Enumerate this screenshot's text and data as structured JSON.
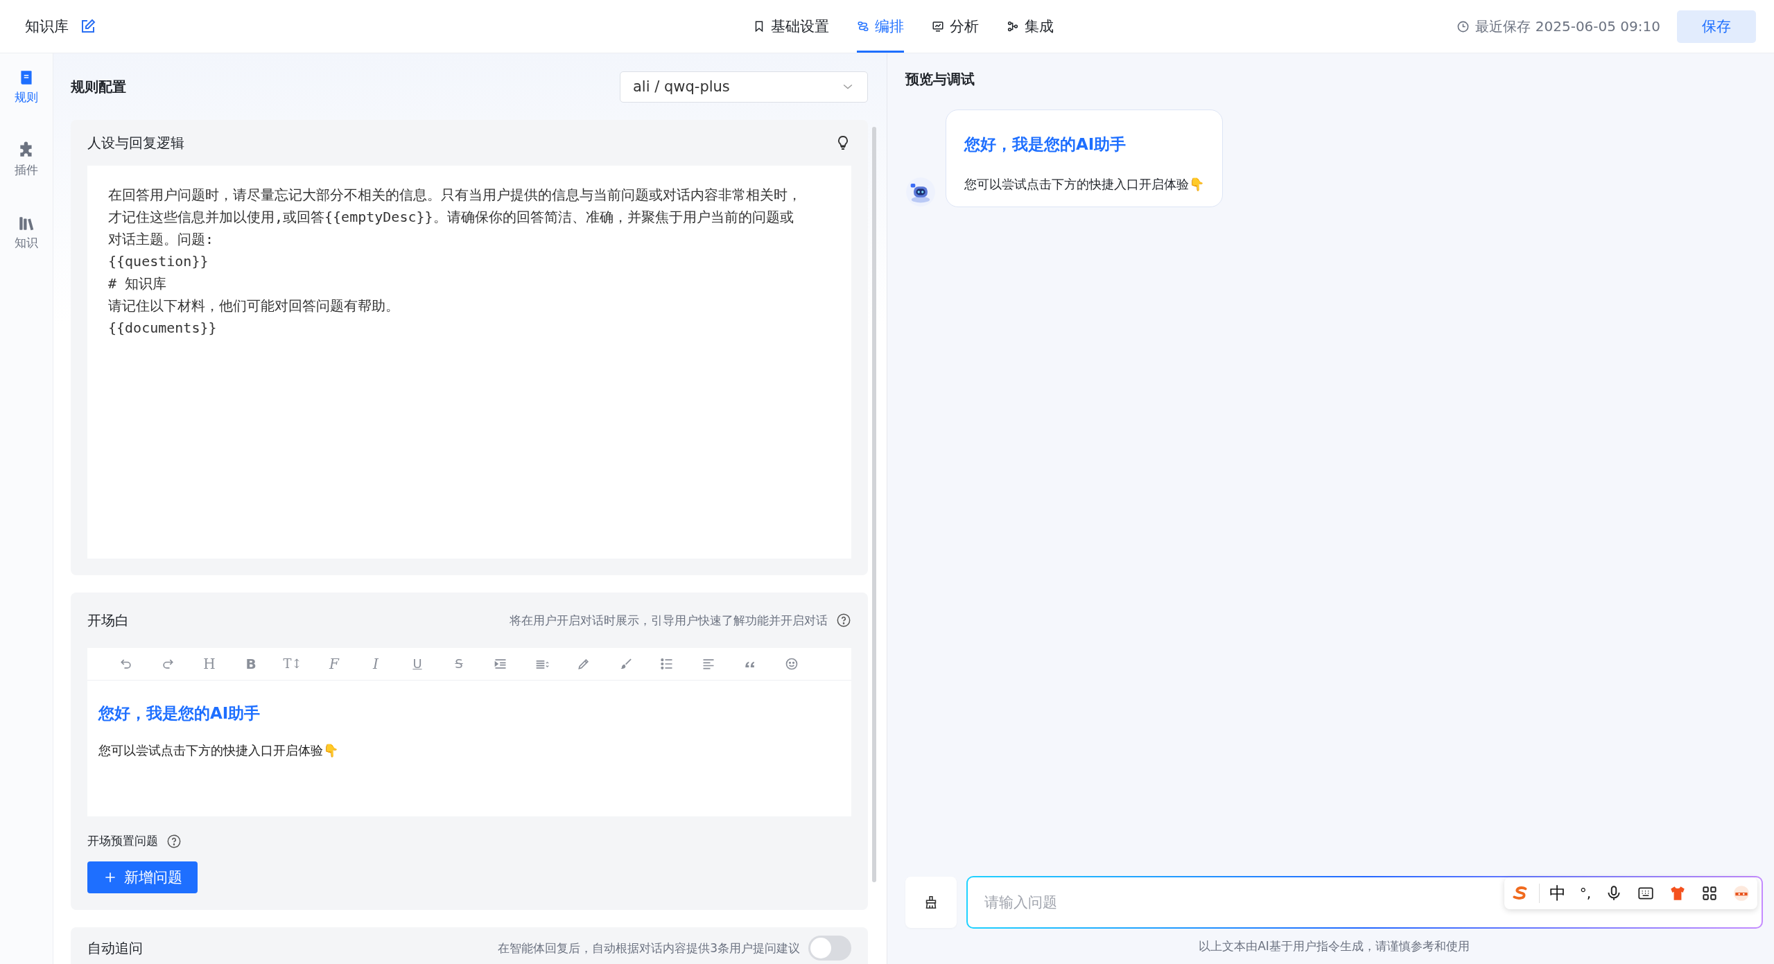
{
  "app": {
    "title": "知识库"
  },
  "nav_tabs": [
    {
      "label": "基础设置",
      "kind": "bookmark",
      "selected": false
    },
    {
      "label": "编排",
      "kind": "flow",
      "selected": true
    },
    {
      "label": "分析",
      "kind": "monitor",
      "selected": false
    },
    {
      "label": "集成",
      "kind": "nodes",
      "selected": false
    }
  ],
  "last_saved": "最近保存 2025-06-05 09:10",
  "save_button": "保存",
  "sidebar": [
    {
      "label": "规则",
      "kind": "book",
      "selected": true
    },
    {
      "label": "插件",
      "kind": "puzzle",
      "selected": false
    },
    {
      "label": "知识",
      "kind": "books",
      "selected": false
    }
  ],
  "rules": {
    "title": "规则配置",
    "model": "ali / qwq-plus",
    "persona": {
      "title": "人设与回复逻辑",
      "prompt_lines": [
        "在回答用户问题时，请尽量忘记大部分不相关的信息。只有当用户提供的信息与当前问题或对话内容非常相关时，才记住这些信息并加以使用,或回答{{emptyDesc}}。请确保你的回答简洁、准确，并聚焦于用户当前的问题或对话主题。问题:",
        "{{question}}",
        "# 知识库",
        "请记住以下材料，他们可能对回答问题有帮助。",
        "{{documents}}"
      ]
    },
    "opening": {
      "title": "开场白",
      "hint": "将在用户开启对话时展示，引导用户快速了解功能并开启对话",
      "toolbar": [
        {
          "kind": "undo"
        },
        {
          "kind": "redo"
        },
        {
          "kind": "heading",
          "text": "H"
        },
        {
          "kind": "bold",
          "text": "B"
        },
        {
          "kind": "font-size",
          "text": "T↕"
        },
        {
          "kind": "font",
          "text": "F"
        },
        {
          "kind": "italic",
          "text": "I"
        },
        {
          "kind": "underline",
          "text": "U"
        },
        {
          "kind": "strike",
          "text": "S"
        },
        {
          "kind": "indent"
        },
        {
          "kind": "line-height"
        },
        {
          "kind": "pen"
        },
        {
          "kind": "brush"
        },
        {
          "kind": "bullet-list"
        },
        {
          "kind": "align-left"
        },
        {
          "kind": "quote"
        },
        {
          "kind": "emoji"
        }
      ],
      "greeting_title": "您好，我是您的AI助手",
      "greeting_text": "您可以尝试点击下方的快捷入口开启体验👇",
      "preset_label": "开场预置问题",
      "add_button": "新增问题"
    },
    "auto_followup": {
      "title": "自动追问",
      "hint": "在智能体回复后，自动根据对话内容提供3条用户提问建议",
      "on": false
    }
  },
  "preview": {
    "title": "预览与调试",
    "message": {
      "title": "您好，我是您的AI助手",
      "text": "您可以尝试点击下方的快捷入口开启体验👇"
    },
    "input": {
      "placeholder": "请输入问题"
    },
    "disclaimer": "以上文本由AI基于用户指令生成，请谨慎参考和使用"
  },
  "ime_toolbar": {
    "mode": "中",
    "punctuation": "°,"
  }
}
